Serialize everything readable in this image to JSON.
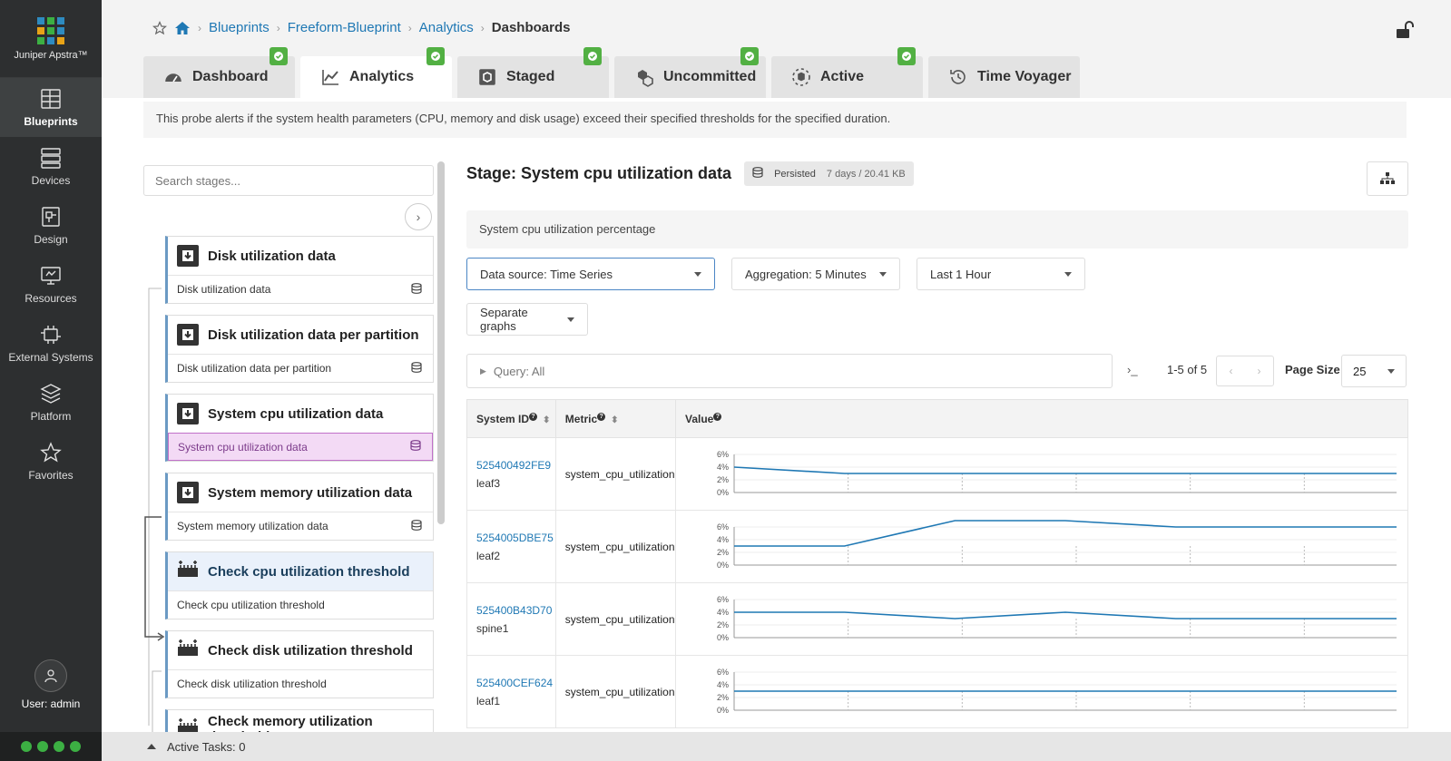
{
  "app": {
    "product_name": "Juniper Apstra™",
    "logo_colors": [
      "#2e8bc0",
      "#3cb043",
      "#2e8bc0",
      "#e8a317",
      "#3cb043",
      "#2e8bc0",
      "#3cb043",
      "#2e8bc0",
      "#e8a317"
    ]
  },
  "nav": {
    "items": [
      {
        "label": "Blueprints",
        "icon": "blueprints-icon"
      },
      {
        "label": "Devices",
        "icon": "devices-icon"
      },
      {
        "label": "Design",
        "icon": "design-icon"
      },
      {
        "label": "Resources",
        "icon": "resources-icon"
      },
      {
        "label": "External Systems",
        "icon": "external-systems-icon"
      },
      {
        "label": "Platform",
        "icon": "platform-icon"
      },
      {
        "label": "Favorites",
        "icon": "star-icon"
      }
    ],
    "user_label": "User: admin"
  },
  "breadcrumb": {
    "items": [
      "Blueprints",
      "Freeform-Blueprint",
      "Analytics"
    ],
    "current": "Dashboards"
  },
  "tabs": [
    {
      "label": "Dashboard",
      "icon": "dashboard-icon",
      "checked": true
    },
    {
      "label": "Analytics",
      "icon": "analytics-icon",
      "checked": true
    },
    {
      "label": "Staged",
      "icon": "staged-icon",
      "checked": true
    },
    {
      "label": "Uncommitted",
      "icon": "uncommitted-icon",
      "checked": true
    },
    {
      "label": "Active",
      "icon": "active-icon",
      "checked": true
    },
    {
      "label": "Time Voyager",
      "icon": "history-icon",
      "checked": false
    }
  ],
  "notice": "This probe alerts if the system health parameters (CPU, memory and disk usage) exceed their specified thresholds for the specified duration.",
  "stages_panel": {
    "search_placeholder": "Search stages...",
    "stages": [
      {
        "title": "Disk utilization data",
        "sub": "Disk utilization data",
        "type": "source"
      },
      {
        "title": "Disk utilization data per partition",
        "sub": "Disk utilization data per partition",
        "type": "source"
      },
      {
        "title": "System cpu utilization data",
        "sub": "System cpu utilization data",
        "type": "source"
      },
      {
        "title": "System memory utilization data",
        "sub": "System memory utilization data",
        "type": "source"
      },
      {
        "title": "Check cpu utilization threshold",
        "sub": "Check cpu utilization threshold",
        "type": "processor"
      },
      {
        "title": "Check disk utilization threshold",
        "sub": "Check disk utilization threshold",
        "type": "processor"
      },
      {
        "title": "Check memory utilization threshold",
        "sub": "",
        "type": "processor"
      }
    ]
  },
  "main": {
    "stage_title": "Stage: System cpu utilization data",
    "persisted_label": "Persisted",
    "persisted_detail": "7 days / 20.41 KB",
    "description": "System cpu utilization percentage",
    "data_source": "Data source: Time Series",
    "aggregation": "Aggregation: 5 Minutes",
    "time_range": "Last 1 Hour",
    "graph_mode": "Separate graphs",
    "query": "Query: All",
    "pager": "1-5 of 5",
    "page_size_label": "Page Size:",
    "page_size": "25",
    "columns": [
      "System ID",
      "Metric",
      "Value"
    ],
    "rows": [
      {
        "system_id": "525400492FE9",
        "label": "leaf3",
        "metric": "system_cpu_utilization"
      },
      {
        "system_id": "5254005DBE75",
        "label": "leaf2",
        "metric": "system_cpu_utilization"
      },
      {
        "system_id": "525400B43D70",
        "label": "spine1",
        "metric": "system_cpu_utilization"
      },
      {
        "system_id": "525400CEF624",
        "label": "leaf1",
        "metric": "system_cpu_utilization"
      }
    ]
  },
  "chart_data": [
    {
      "type": "line",
      "yticks": [
        "6%",
        "4%",
        "2%",
        "0%"
      ],
      "ylim": [
        0,
        6
      ],
      "x": [
        0,
        1,
        2,
        3,
        4,
        5,
        6
      ],
      "series": [
        {
          "values": [
            4.0,
            3.0,
            3.0,
            3.0,
            3.0,
            3.0,
            3.0
          ]
        }
      ]
    },
    {
      "type": "line",
      "yticks": [
        "6%",
        "4%",
        "2%",
        "0%"
      ],
      "ylim": [
        0,
        6
      ],
      "x": [
        0,
        1,
        2,
        3,
        4,
        5,
        6
      ],
      "series": [
        {
          "values": [
            3.0,
            3.0,
            7.0,
            7.0,
            6.0,
            6.0,
            6.0
          ]
        }
      ]
    },
    {
      "type": "line",
      "yticks": [
        "6%",
        "4%",
        "2%",
        "0%"
      ],
      "ylim": [
        0,
        6
      ],
      "x": [
        0,
        1,
        2,
        3,
        4,
        5,
        6
      ],
      "series": [
        {
          "values": [
            4.0,
            4.0,
            3.0,
            4.0,
            3.0,
            3.0,
            3.0
          ]
        }
      ]
    },
    {
      "type": "line",
      "yticks": [
        "6%",
        "4%",
        "2%",
        "0%"
      ],
      "ylim": [
        0,
        6
      ],
      "x": [
        0,
        1,
        2,
        3,
        4,
        5,
        6
      ],
      "series": [
        {
          "values": [
            3.0,
            3.0,
            3.0,
            3.0,
            3.0,
            3.0,
            3.0
          ]
        }
      ]
    }
  ],
  "bottom": {
    "active_tasks": "Active Tasks: 0"
  },
  "colors": {
    "accent": "#1f78b4",
    "check": "#52b043",
    "line": "#1f78b4",
    "status_dot": "#3cb043"
  }
}
